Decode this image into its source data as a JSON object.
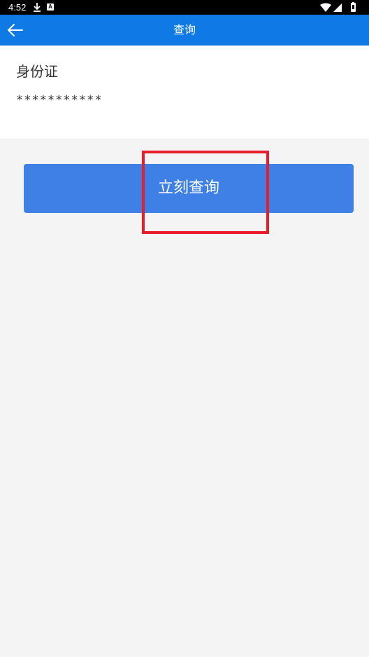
{
  "status_bar": {
    "time": "4:52",
    "icons": [
      "download-icon",
      "a-badge-icon",
      "wifi-icon",
      "signal-icon",
      "battery-icon"
    ],
    "a_badge": "A"
  },
  "app_bar": {
    "title": "查询",
    "back_icon": "arrow-left-icon",
    "background": "#0f7ae5"
  },
  "form": {
    "id_label": "身份证",
    "id_value": "***********"
  },
  "actions": {
    "query_label": "立刻查询",
    "query_color": "#3f80e6"
  },
  "annotation": {
    "highlight_color": "#e81c2b"
  }
}
